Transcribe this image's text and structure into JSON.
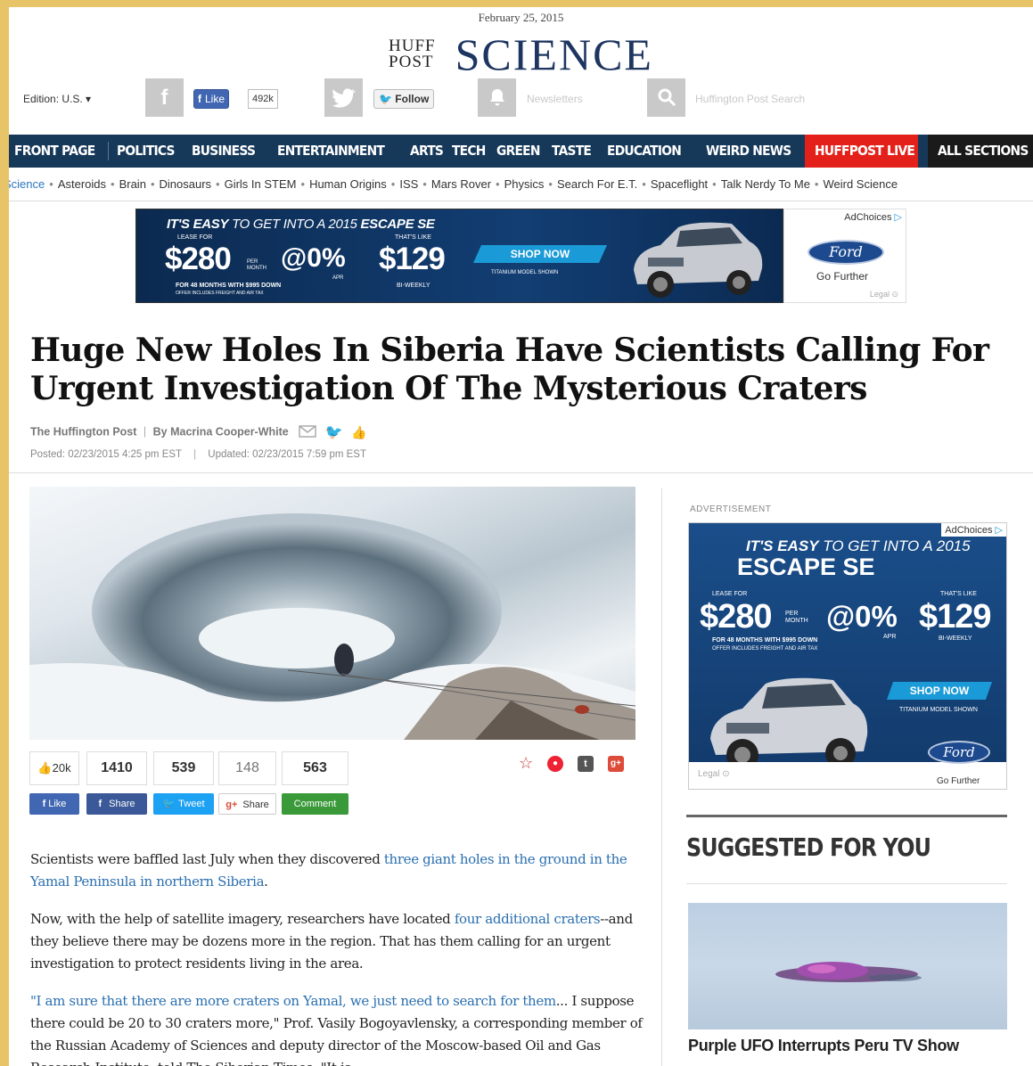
{
  "header": {
    "date": "February 25, 2015",
    "logo_huff": "HUFF",
    "logo_post": "POST",
    "section_title": "SCIENCE"
  },
  "toolbar": {
    "edition": "Edition: U.S. ▾",
    "fb_like": "Like",
    "fb_count": "492k",
    "follow": "Follow",
    "newsletters": "Newsletters",
    "search_placeholder": "Huffington Post Search"
  },
  "nav": {
    "items": [
      "FRONT PAGE",
      "POLITICS",
      "BUSINESS",
      "ENTERTAINMENT",
      "ARTS",
      "TECH",
      "GREEN",
      "TASTE",
      "EDUCATION",
      "WEIRD NEWS"
    ],
    "live": "HUFFPOST LIVE",
    "all_sections": "ALL SECTIONS"
  },
  "subnav": {
    "items": [
      "Science",
      "Asteroids",
      "Brain",
      "Dinosaurs",
      "Girls In STEM",
      "Human Origins",
      "ISS",
      "Mars Rover",
      "Physics",
      "Search For E.T.",
      "Spaceflight",
      "Talk Nerdy To Me",
      "Weird Science"
    ]
  },
  "banner_ad": {
    "headline_1": "IT'S EASY",
    "headline_2": " TO GET INTO A 2015 ",
    "headline_3": "ESCAPE SE",
    "lease_for": "LEASE FOR",
    "price": "$280",
    "per_month": "PER MONTH",
    "apr": "@0%",
    "apr_label": "APR",
    "thats_like": "THAT'S LIKE",
    "biweekly_price": "$129",
    "biweekly_label": "BI-WEEKLY",
    "terms": "FOR 48 MONTHS WITH $995 DOWN",
    "terms2": "OFFER INCLUDES FREIGHT AND AIR TAX",
    "shop_now": "SHOP NOW",
    "model_shown": "TITANIUM MODEL SHOWN",
    "adchoices": "AdChoices",
    "brand": "Ford",
    "go_further": "Go Further",
    "legal": "Legal"
  },
  "article": {
    "title": "Huge New Holes In Siberia Have Scientists Calling For Urgent Investigation Of The Mysterious Craters",
    "source": "The Huffington Post",
    "author": "By Macrina Cooper-White",
    "posted": "Posted: 02/23/2015 4:25 pm EST",
    "updated": "Updated: 02/23/2015 7:59 pm EST",
    "p1_a": "Scientists were baffled last July when they discovered ",
    "p1_link": "three giant holes in the ground in the Yamal Peninsula in northern Siberia",
    "p1_b": ".",
    "p2_a": "Now, with the help of satellite imagery, researchers have located ",
    "p2_link": "four additional craters",
    "p2_b": "--and they believe there may be dozens more in the region. That has them calling for an urgent investigation to protect residents living in the area.",
    "p3_link": "\"I am sure that there are more craters on Yamal, we just need to search for them",
    "p3_b": "... I suppose there could be 20 to 30 craters more,\" Prof. Vasily Bogoyavlensky, a corresponding member of the Russian Academy of Sciences and deputy director of the Moscow-based Oil and Gas Research Institute, told The Siberian Times. \"It is"
  },
  "share": {
    "likes": "20k",
    "facebook": "1410",
    "twitter": "539",
    "gplus": "148",
    "comments": "563",
    "like_btn": "Like",
    "share_btn": "Share",
    "tweet_btn": "Tweet",
    "gshare_btn": "Share",
    "comment_btn": "Comment"
  },
  "sidebar": {
    "advertisement": "ADVERTISEMENT",
    "suggested": "SUGGESTED FOR YOU",
    "thumb_caption": "Purple UFO Interrupts Peru TV Show"
  },
  "colors": {
    "nav_bg": "#16395a",
    "live_bg": "#e3211a",
    "science_blue": "#1d3560",
    "link": "#2a6fb0",
    "frame": "#e8c468"
  }
}
